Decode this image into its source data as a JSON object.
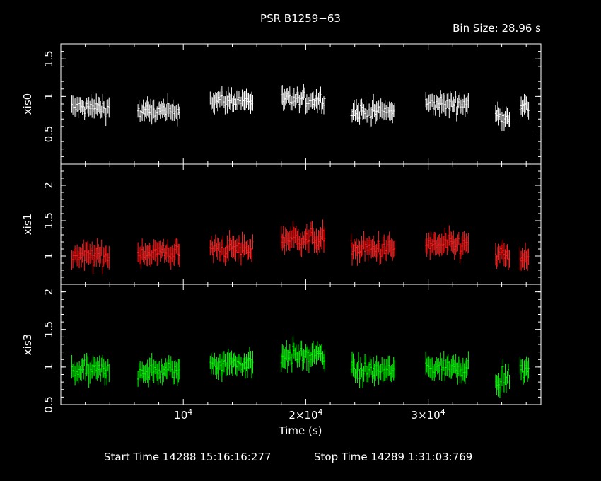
{
  "title": "PSR B1259−63",
  "bin_size": "Bin Size: 28.96 s",
  "x_axis_label": "Time (s)",
  "footer": {
    "start_time": "Start Time 14288 15:16:16:277",
    "stop_time": "Stop Time 14289  1:31:03:769"
  },
  "chart_data": {
    "type": "line",
    "x_ticks": [
      {
        "base": "10",
        "exp": "4",
        "prefix": ""
      },
      {
        "base": "×10",
        "exp": "4",
        "prefix": "2"
      },
      {
        "base": "×10",
        "exp": "4",
        "prefix": "3"
      }
    ],
    "xlabel": "Time (s)",
    "xlim": [
      0,
      39200
    ],
    "segments": [
      [
        900,
        4000
      ],
      [
        6300,
        9700
      ],
      [
        12200,
        15700
      ],
      [
        18000,
        21600
      ],
      [
        23700,
        27300
      ],
      [
        29800,
        33300
      ],
      [
        35500,
        36700
      ],
      [
        37500,
        38200
      ]
    ],
    "panels": [
      {
        "ylabel": "xis0",
        "color": "#ffffff",
        "ylim": [
          0.1,
          1.7
        ],
        "yticks": [
          "0.5",
          "1",
          "1.5"
        ],
        "ytick_values": [
          0.5,
          1,
          1.5
        ],
        "segment_means": [
          0.85,
          0.8,
          0.95,
          0.95,
          0.8,
          0.9,
          0.75,
          0.85
        ],
        "noise": 0.13
      },
      {
        "ylabel": "xis1",
        "color": "#ff2020",
        "ylim": [
          0.6,
          2.3
        ],
        "yticks": [
          "1",
          "1.5",
          "2"
        ],
        "ytick_values": [
          1,
          1.5,
          2
        ],
        "segment_means": [
          1.0,
          1.05,
          1.1,
          1.25,
          1.1,
          1.15,
          1.0,
          0.95
        ],
        "noise": 0.16
      },
      {
        "ylabel": "xis3",
        "color": "#00ff00",
        "ylim": [
          0.5,
          2.1
        ],
        "yticks": [
          "0.5",
          "1",
          "1.5",
          "2"
        ],
        "ytick_values": [
          0.5,
          1,
          1.5,
          2
        ],
        "segment_means": [
          0.95,
          0.95,
          1.05,
          1.15,
          0.95,
          1.0,
          0.85,
          0.95
        ],
        "noise": 0.15
      }
    ]
  }
}
